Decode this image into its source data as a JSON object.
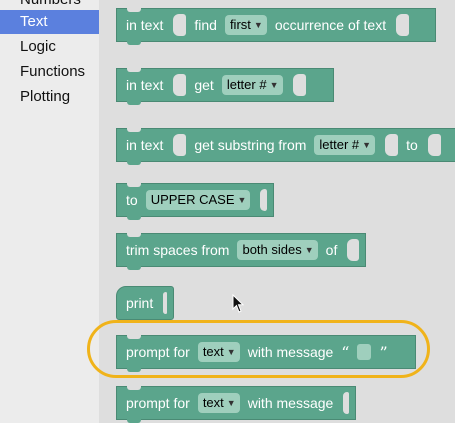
{
  "sidebar": {
    "items": [
      {
        "label": "Numbers"
      },
      {
        "label": "Text"
      },
      {
        "label": "Logic"
      },
      {
        "label": "Functions"
      },
      {
        "label": "Plotting"
      }
    ],
    "selected": "Text"
  },
  "blocks": {
    "find_occurrence": {
      "in_text": "in text",
      "find": "find",
      "dropdown": "first",
      "tail": "occurrence of text"
    },
    "get_letter": {
      "in_text": "in text",
      "get": "get",
      "dropdown": "letter #"
    },
    "get_substring": {
      "in_text": "in text",
      "label": "get substring from",
      "dropdown": "letter #",
      "to": "to"
    },
    "to_case": {
      "to": "to",
      "dropdown": "UPPER CASE"
    },
    "trim": {
      "label": "trim spaces from",
      "dropdown": "both sides",
      "of": "of"
    },
    "print": {
      "label": "print"
    },
    "prompt_message": {
      "label": "prompt for",
      "dropdown": "text",
      "with": "with message",
      "open_quote": "“",
      "close_quote": "”"
    },
    "prompt_plain": {
      "label": "prompt for",
      "dropdown": "text",
      "with": "with message"
    }
  },
  "colors": {
    "block": "#5ba58c",
    "dropdown": "#9fcfbd",
    "selected_category": "#5b80de",
    "highlight": "#f0b31a"
  },
  "icons": {
    "dropdown": "triangle-down",
    "cursor": "mouse-pointer"
  }
}
